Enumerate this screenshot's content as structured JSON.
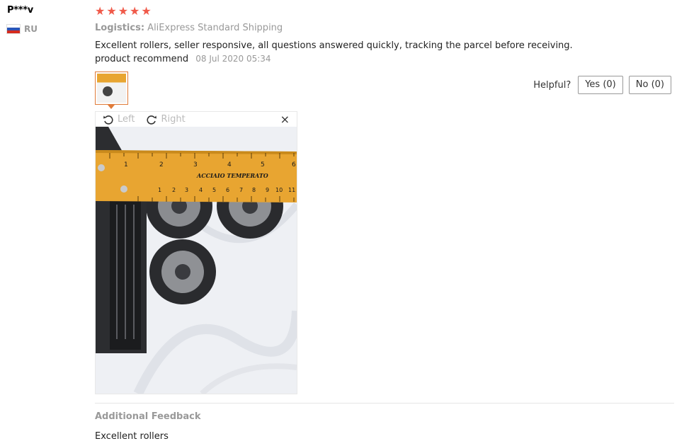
{
  "reviewer": {
    "name": "P***v",
    "country": "RU"
  },
  "rating": {
    "stars": 5,
    "max": 5,
    "color": "#f05a4a"
  },
  "logistics": {
    "label": "Logistics:",
    "value": "AliExpress Standard Shipping"
  },
  "review": {
    "text": "Excellent rollers, seller responsive, all questions answered quickly, tracking the parcel before receiving. product recommend",
    "date": "08 Jul 2020 05:34"
  },
  "helpful": {
    "label": "Helpful?",
    "yes": "Yes (0)",
    "no": "No (0)"
  },
  "viewer": {
    "rotate_left": "Left",
    "rotate_right": "Right",
    "close": "×",
    "ruler_text": "ACCIAIO TEMPERATO",
    "ruler_top_numbers": [
      "1",
      "2",
      "3",
      "4",
      "5",
      "6"
    ],
    "ruler_bottom_numbers": [
      "1",
      "2",
      "3",
      "4",
      "5",
      "6",
      "7",
      "8",
      "9",
      "10",
      "11"
    ]
  },
  "additional_feedback": {
    "title": "Additional Feedback",
    "text": "Excellent rollers"
  },
  "colors": {
    "accent": "#e07b39",
    "ruler": "#e8a531"
  }
}
